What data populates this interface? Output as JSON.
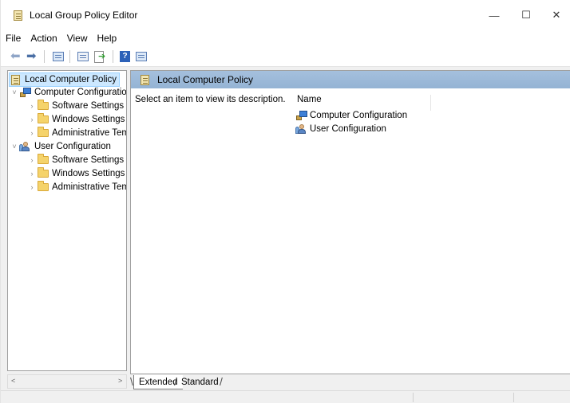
{
  "window": {
    "title": "Local Group Policy Editor",
    "minimize_glyph": "—",
    "maximize_glyph": "☐",
    "close_glyph": "✕"
  },
  "menu": [
    "File",
    "Action",
    "View",
    "Help"
  ],
  "toolbar": {
    "icons": [
      "back-arrow-icon",
      "forward-arrow-icon",
      "show-hide-tree-icon",
      "properties-icon",
      "export-list-icon",
      "help-icon",
      "show-action-pane-icon"
    ]
  },
  "tree": {
    "root": {
      "label": "Local Computer Policy",
      "icon": "policy-document-icon",
      "selected": true
    },
    "nodes": [
      {
        "label": "Computer Configuration",
        "icon": "computer-icon",
        "expanded": true,
        "children": [
          {
            "label": "Software Settings",
            "icon": "folder-icon"
          },
          {
            "label": "Windows Settings",
            "icon": "folder-icon"
          },
          {
            "label": "Administrative Templates",
            "icon": "folder-icon"
          }
        ]
      },
      {
        "label": "User Configuration",
        "icon": "users-icon",
        "expanded": true,
        "children": [
          {
            "label": "Software Settings",
            "icon": "folder-icon"
          },
          {
            "label": "Windows Settings",
            "icon": "folder-icon"
          },
          {
            "label": "Administrative Templates",
            "icon": "folder-icon"
          }
        ]
      }
    ],
    "expand_glyph": "›",
    "collapse_glyph": "˅"
  },
  "content": {
    "header_title": "Local Computer Policy",
    "description": "Select an item to view its description.",
    "column_name": "Name",
    "items": [
      {
        "label": "Computer Configuration",
        "icon": "computer-icon"
      },
      {
        "label": "User Configuration",
        "icon": "users-icon"
      }
    ]
  },
  "tabs": [
    "Extended",
    "Standard"
  ],
  "scrollbar": {
    "left_glyph": "<",
    "right_glyph": ">"
  },
  "colors": {
    "header_blue": "#a5c0dd",
    "selection": "#cce8ff",
    "folder": "#f5d36b"
  }
}
